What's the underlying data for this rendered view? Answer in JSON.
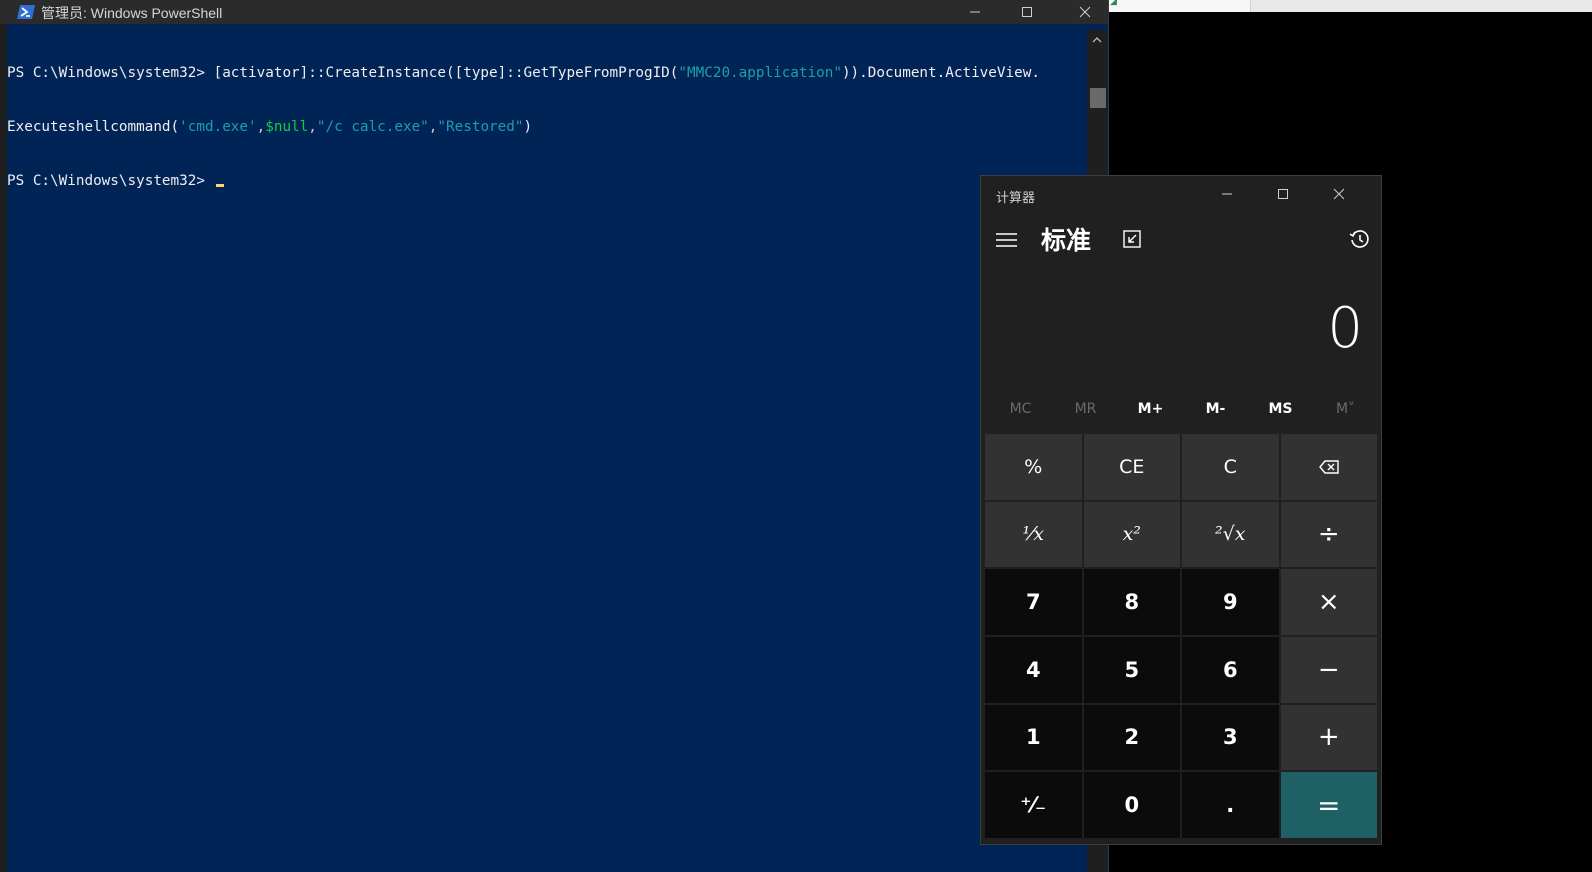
{
  "powershell": {
    "title": "管理员: Windows PowerShell",
    "line1_prompt": "PS C:\\Windows\\system32> ",
    "line1_code_a": "[activator]::CreateInstance([type]::GetTypeFromProgID(",
    "line1_str_a": "\"MMC20.application\"",
    "line1_code_b": ")).Document.ActiveView.",
    "line2_code_a": "Executeshellcommand(",
    "line2_str_a": "'cmd.exe'",
    "line2_comma_a": ",",
    "line2_var": "$null",
    "line2_comma_b": ",",
    "line2_str_b": "\"/c calc.exe\"",
    "line2_comma_c": ",",
    "line2_str_c": "\"Restored\"",
    "line2_close": ")",
    "line3_prompt": "PS C:\\Windows\\system32> ",
    "colors": {
      "background": "#012456",
      "text": "#eeedf0",
      "string": "#1a9fae",
      "variable": "#13c94a"
    }
  },
  "calculator": {
    "title": "计算器",
    "mode": "标准",
    "display": "0",
    "memory": [
      {
        "label": "MC",
        "enabled": false
      },
      {
        "label": "MR",
        "enabled": false
      },
      {
        "label": "M+",
        "enabled": true
      },
      {
        "label": "M-",
        "enabled": true
      },
      {
        "label": "MS",
        "enabled": true
      },
      {
        "label": "M˅",
        "enabled": false
      }
    ],
    "keys": {
      "percent": "%",
      "ce": "CE",
      "c": "C",
      "reciprocal": "¹⁄x",
      "square": "x²",
      "sqrt": "²√x",
      "divide": "÷",
      "n7": "7",
      "n8": "8",
      "n9": "9",
      "multiply": "×",
      "n4": "4",
      "n5": "5",
      "n6": "6",
      "minus": "−",
      "n1": "1",
      "n2": "2",
      "n3": "3",
      "plus": "+",
      "negate": "⁺⁄₋",
      "n0": "0",
      "decimal": ".",
      "equals": "="
    },
    "colors": {
      "background": "#202020",
      "equals": "#1f5f66"
    }
  }
}
